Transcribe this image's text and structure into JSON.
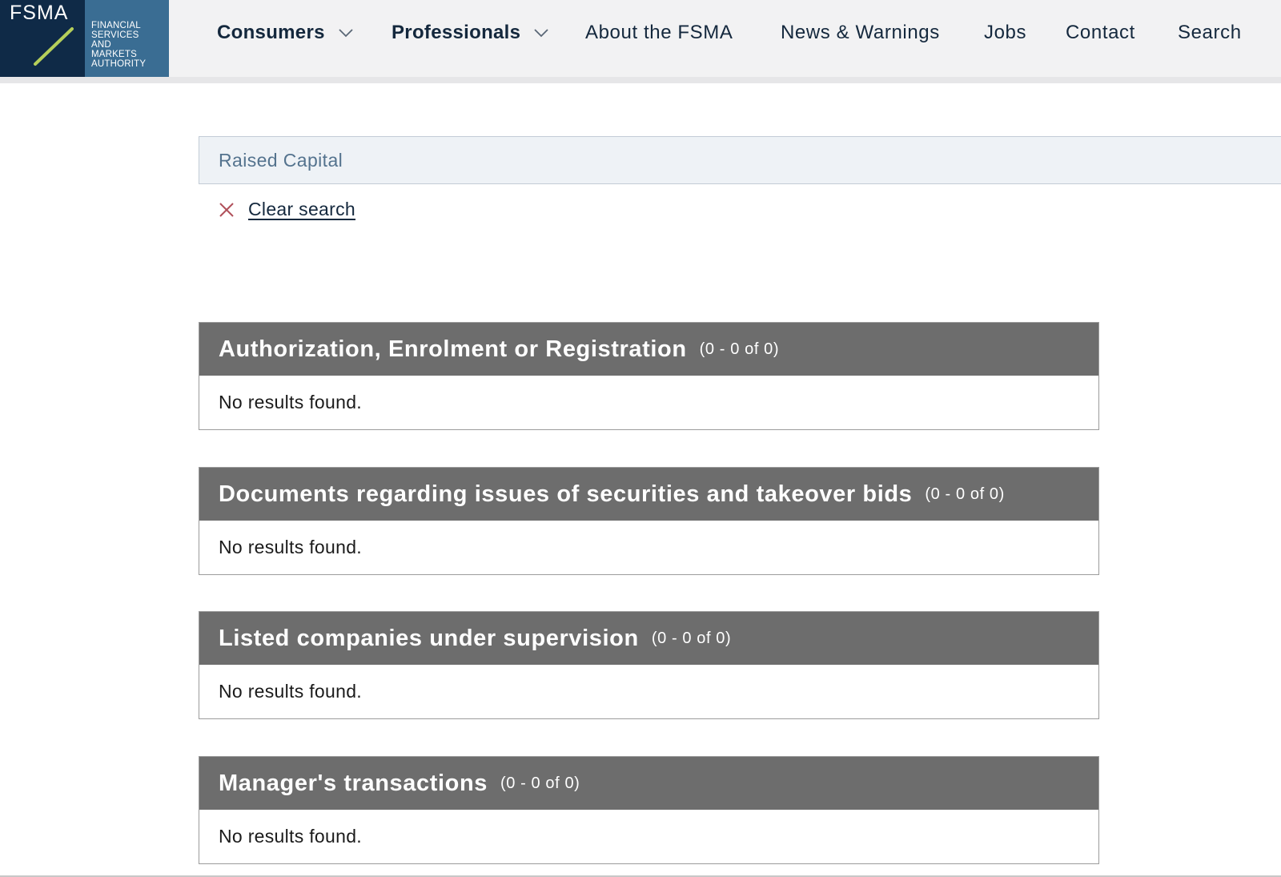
{
  "logo": {
    "wordmark": "FSMA",
    "lines": [
      "Financial",
      "Services",
      "and",
      "Markets",
      "Authority"
    ],
    "colors": {
      "dark": "#0f2a47",
      "light": "#3a6d93",
      "slash": "#b5cf5a"
    }
  },
  "nav": {
    "consumers": "Consumers",
    "professionals": "Professionals",
    "about": "About the FSMA",
    "news": "News & Warnings",
    "jobs": "Jobs",
    "contact": "Contact",
    "search": "Search"
  },
  "search": {
    "value": "Raised Capital",
    "clear_label": "Clear search"
  },
  "sections": [
    {
      "title": "Authorization, Enrolment or Registration",
      "count": "(0 - 0 of 0)",
      "message": "No results found."
    },
    {
      "title": "Documents regarding issues of securities and takeover bids",
      "count": "(0 - 0 of 0)",
      "message": "No results found."
    },
    {
      "title": "Listed companies under supervision",
      "count": "(0 - 0 of 0)",
      "message": "No results found."
    },
    {
      "title": "Manager's transactions",
      "count": "(0 - 0 of 0)",
      "message": "No results found."
    }
  ],
  "colors": {
    "section_header": "#6d6d6d",
    "clear_icon": "#b0505a",
    "nav_text": "#14283d"
  }
}
